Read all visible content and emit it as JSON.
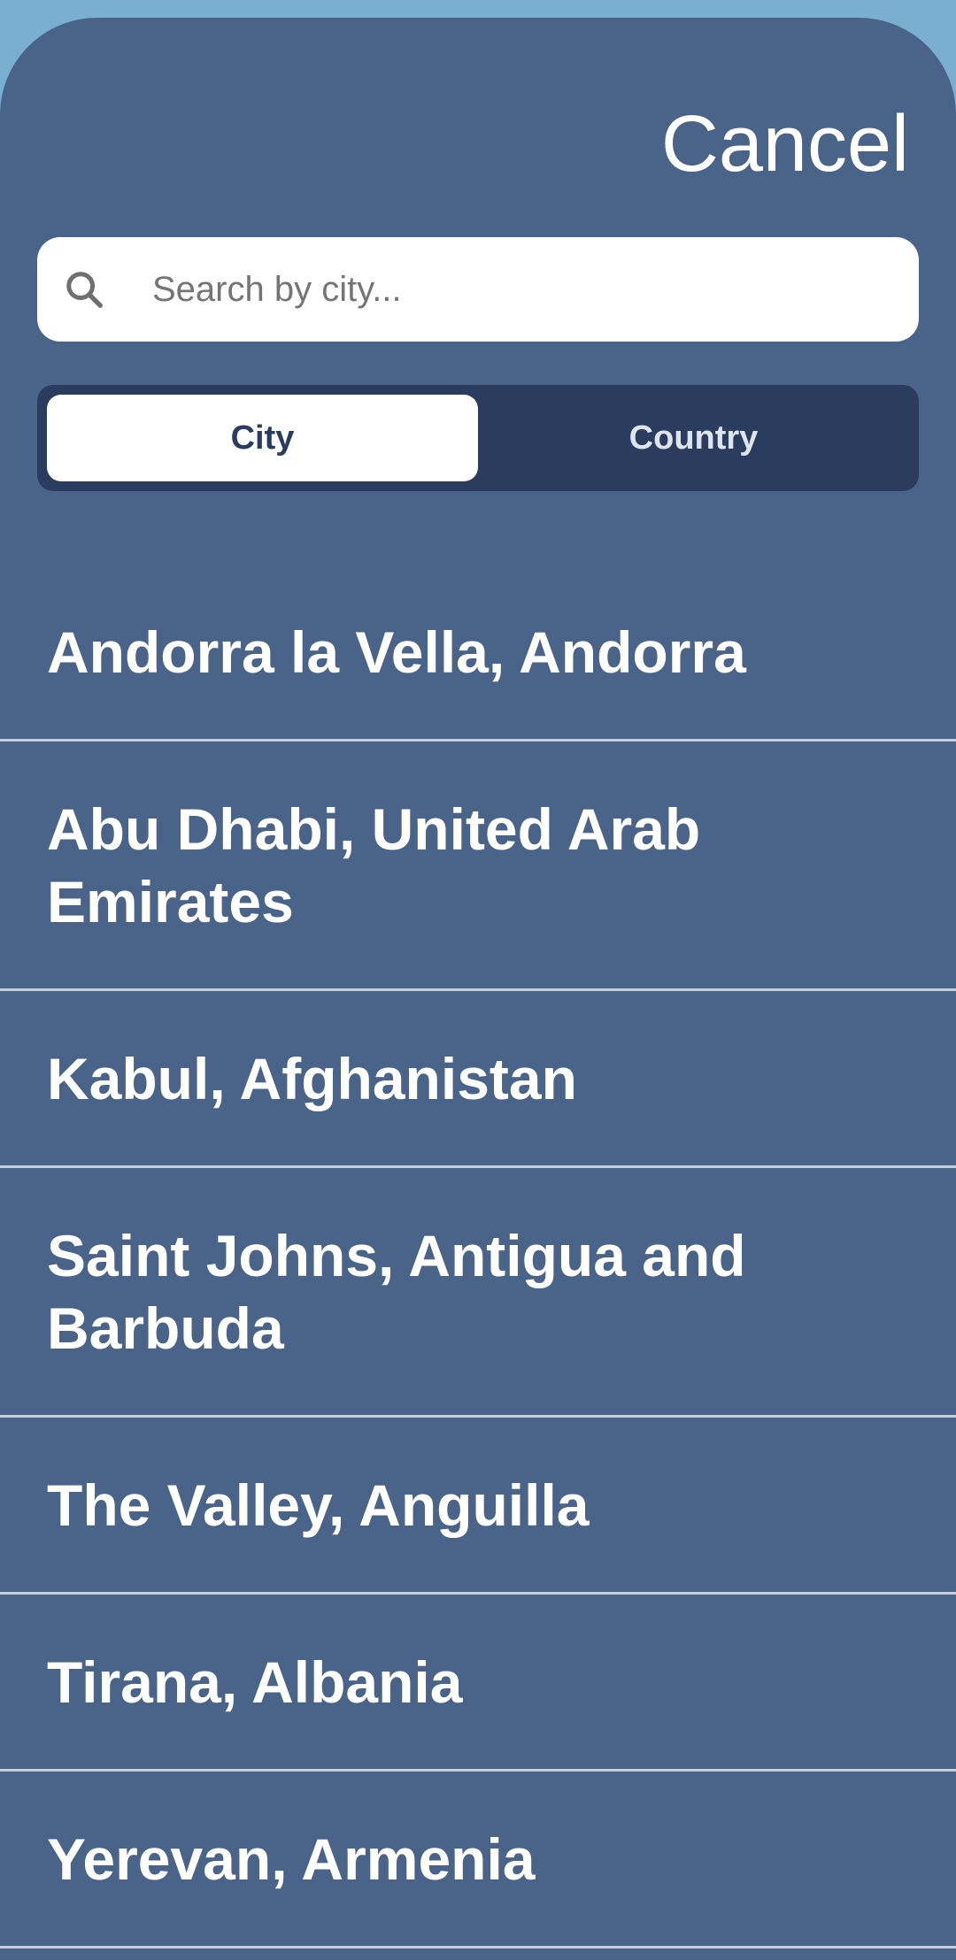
{
  "header": {
    "cancel_label": "Cancel"
  },
  "search": {
    "icon": "search-icon",
    "placeholder": "Search by city...",
    "value": ""
  },
  "tabs": [
    {
      "label": "City",
      "selected": true
    },
    {
      "label": "Country",
      "selected": false
    }
  ],
  "results": [
    {
      "label": "Andorra la Vella, Andorra"
    },
    {
      "label": "Abu Dhabi, United Arab Emirates"
    },
    {
      "label": "Kabul, Afghanistan"
    },
    {
      "label": "Saint Johns, Antigua and Barbuda"
    },
    {
      "label": "The Valley, Anguilla"
    },
    {
      "label": "Tirana, Albania"
    },
    {
      "label": "Yerevan, Armenia"
    }
  ],
  "colors": {
    "backdrop": "#7aafd2",
    "sheet": "#4a6489",
    "segment_track": "#2b3d5f",
    "segment_active": "#ffffff",
    "divider": "#c6cfdc"
  }
}
